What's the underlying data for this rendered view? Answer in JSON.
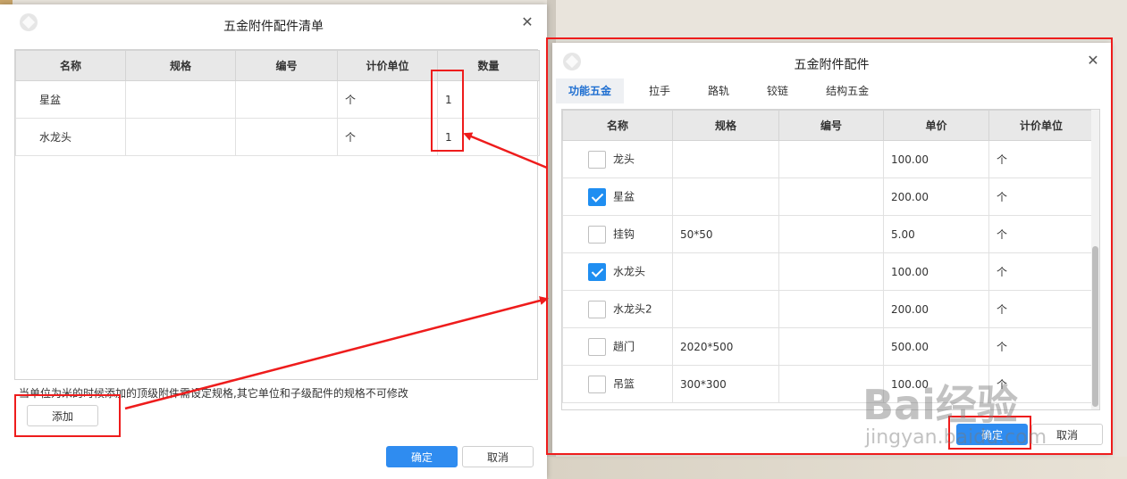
{
  "left_dialog": {
    "title": "五金附件配件清单",
    "columns": [
      "名称",
      "规格",
      "编号",
      "计价单位",
      "数量"
    ],
    "rows": [
      {
        "name": "星盆",
        "spec": "",
        "code": "",
        "unit": "个",
        "qty": "1"
      },
      {
        "name": "水龙头",
        "spec": "",
        "code": "",
        "unit": "个",
        "qty": "1"
      }
    ],
    "hint": "当单位为米的时候添加的顶级附件需设定规格,其它单位和子级配件的规格不可修改",
    "add_label": "添加",
    "ok_label": "确定",
    "cancel_label": "取消"
  },
  "right_dialog": {
    "title": "五金附件配件",
    "tabs": [
      "功能五金",
      "拉手",
      "路轨",
      "铰链",
      "结构五金"
    ],
    "active_tab": "功能五金",
    "columns": [
      "名称",
      "规格",
      "编号",
      "单价",
      "计价单位"
    ],
    "rows": [
      {
        "checked": false,
        "name": "龙头",
        "spec": "",
        "code": "",
        "price": "100.00",
        "unit": "个"
      },
      {
        "checked": true,
        "name": "星盆",
        "spec": "",
        "code": "",
        "price": "200.00",
        "unit": "个"
      },
      {
        "checked": false,
        "name": "挂钩",
        "spec": "50*50",
        "code": "",
        "price": "5.00",
        "unit": "个"
      },
      {
        "checked": true,
        "name": "水龙头",
        "spec": "",
        "code": "",
        "price": "100.00",
        "unit": "个"
      },
      {
        "checked": false,
        "name": "水龙头2",
        "spec": "",
        "code": "",
        "price": "200.00",
        "unit": "个"
      },
      {
        "checked": false,
        "name": "趟门",
        "spec": "2020*500",
        "code": "",
        "price": "500.00",
        "unit": "个"
      },
      {
        "checked": false,
        "name": "吊篮",
        "spec": "300*300",
        "code": "",
        "price": "100.00",
        "unit": "个"
      }
    ],
    "ok_label": "确定",
    "cancel_label": "取消"
  },
  "watermark": {
    "brand": "Bai经验",
    "url": "jingyan.baidu.com"
  },
  "colors": {
    "primary": "#2f8cf0",
    "annotation": "#ee1c1c",
    "checked": "#1f8ef1"
  }
}
